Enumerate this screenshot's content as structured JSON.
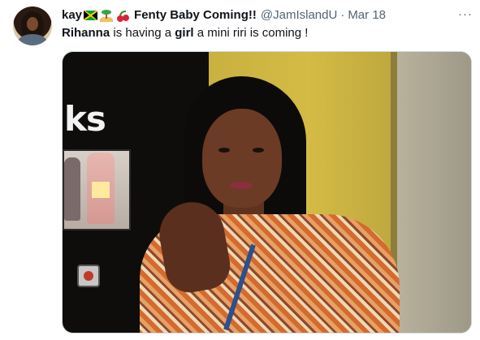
{
  "tweet": {
    "display_name": "kay",
    "name_emojis": [
      "jamaica-flag",
      "desert-island",
      "cherries"
    ],
    "headline": "Fenty Baby Coming!!",
    "handle": "@JamIslandU",
    "separator": "·",
    "date": "Mar 18",
    "more_label": "···",
    "text_parts": {
      "p1": "Rihanna",
      "p2": " is having a ",
      "p3": "girl",
      "p4": " a mini riri is coming !"
    },
    "media": {
      "sign_text": "ks"
    }
  },
  "colors": {
    "text_primary": "#0f1419",
    "text_secondary": "#536471",
    "border": "#cfd9de"
  }
}
